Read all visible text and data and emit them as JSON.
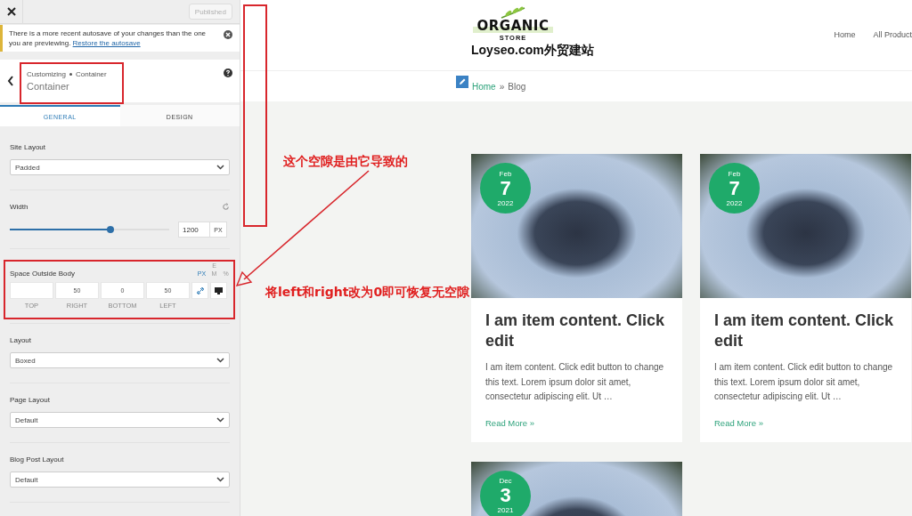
{
  "topbar": {
    "publish_button": "Published",
    "publish_disabled": true
  },
  "notice": {
    "text": "There is a more recent autosave of your changes than the one you are previewing.",
    "link": "Restore the autosave"
  },
  "section": {
    "breadcrumb": [
      "Customizing",
      "Container"
    ],
    "title": "Container"
  },
  "tabs": [
    {
      "label": "GENERAL",
      "selected": true
    },
    {
      "label": "DESIGN",
      "selected": false
    }
  ],
  "controls": [
    {
      "kind": "select",
      "label": "Site Layout",
      "value": "Padded"
    },
    {
      "kind": "slider",
      "label": "Width",
      "level": 0.63,
      "value": "1200",
      "unit": "PX"
    },
    {
      "kind": "spacing",
      "label": "Space Outside Body",
      "units": [
        {
          "label": "PX",
          "selected": true
        },
        {
          "label": "EM",
          "selected": false
        },
        {
          "label": "%",
          "selected": false
        }
      ],
      "fields": [
        {
          "caption": "TOP"
        },
        {
          "value": "50",
          "caption": "RIGHT"
        },
        {
          "value": "0",
          "caption": "BOTTOM"
        },
        {
          "value": "50",
          "caption": "LEFT"
        }
      ],
      "linked": true
    },
    {
      "kind": "select",
      "label": "Layout",
      "value": "Boxed"
    },
    {
      "kind": "select",
      "label": "Page Layout",
      "value": "Default"
    },
    {
      "kind": "select",
      "label": "Blog Post Layout",
      "value": "Default"
    }
  ],
  "site": {
    "logo_top": "ORGANIC",
    "logo_bottom": "STORE",
    "title": "Loyseo.com外贸建站",
    "nav": [
      "Home",
      "All Product"
    ],
    "breadcrumb": {
      "link": "Home",
      "separator": "»",
      "current": "Blog"
    }
  },
  "posts": [
    {
      "month": "Feb",
      "day": "7",
      "year": "2022",
      "title": "I am item content. Click edit",
      "excerpt": "I am item content. Click edit button to change this text. Lorem ipsum dolor sit amet, consectetur adipiscing elit. Ut …",
      "read_more": "Read More »"
    },
    {
      "month": "Feb",
      "day": "7",
      "year": "2022",
      "title": "I am item content. Click edit",
      "excerpt": "I am item content. Click edit button to change this text. Lorem ipsum dolor sit amet, consectetur adipiscing elit. Ut …",
      "read_more": "Read More »"
    },
    {
      "month": "Dec",
      "day": "3",
      "year": "2021"
    }
  ],
  "annotations": [
    "这个空隙是由它导致的",
    "将left和right改为0即可恢复无空隙"
  ]
}
